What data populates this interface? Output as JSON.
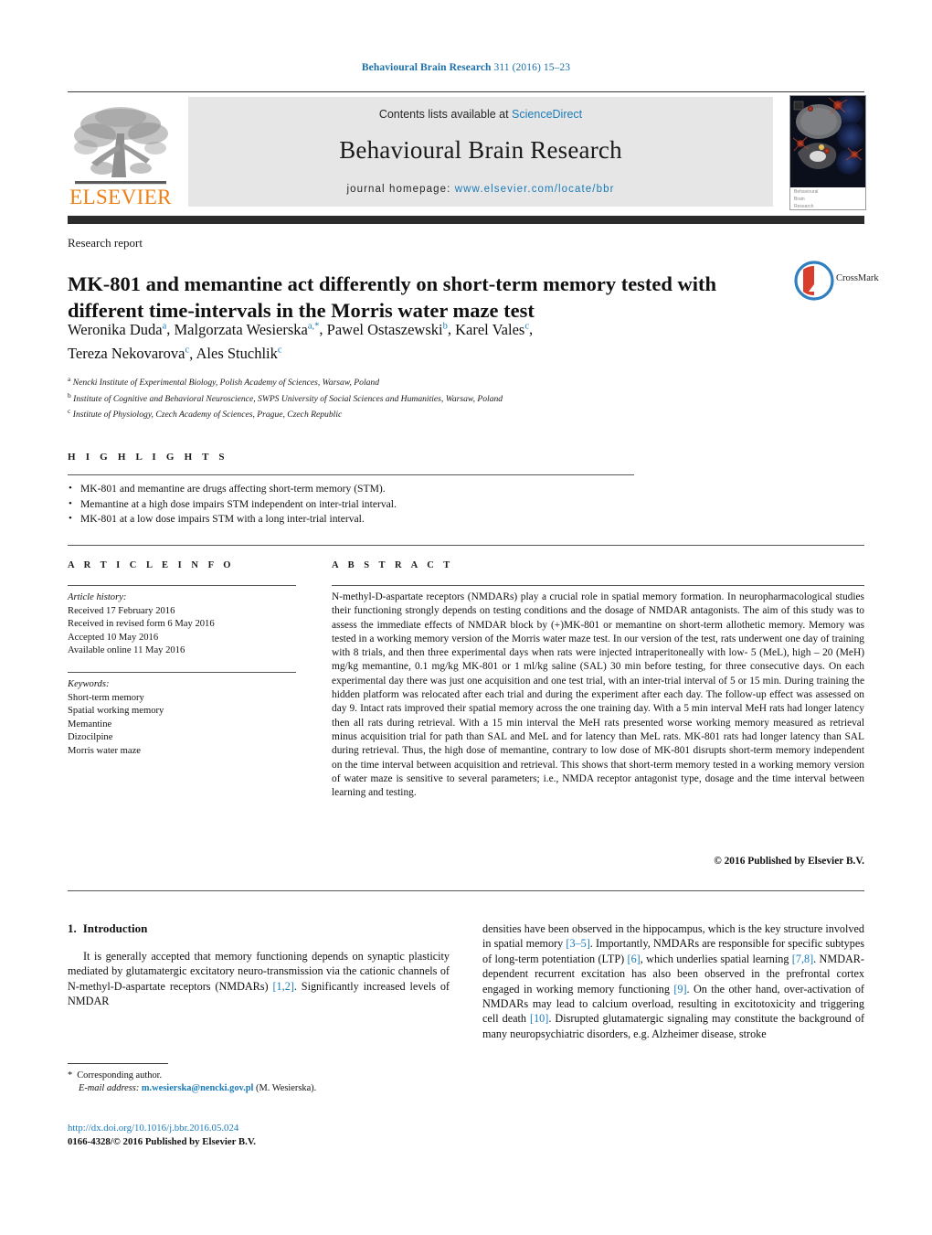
{
  "running_head": {
    "journal": "Behavioural Brain Research",
    "volume_info": "311 (2016) 15–23"
  },
  "masthead": {
    "contents_prefix": "Contents lists available at ",
    "contents_link": "ScienceDirect",
    "journal_title": "Behavioural Brain Research",
    "homepage_prefix": "journal homepage: ",
    "homepage_url": "www.elsevier.com/locate/bbr",
    "publisher_logo_text": "ELSEVIER",
    "cover_caption_line1": "Behavioural",
    "cover_caption_line2": "Brain",
    "cover_caption_line3": "Research"
  },
  "article": {
    "doctype": "Research report",
    "title": "MK-801 and memantine act differently on short-term memory tested with different time-intervals in the Morris water maze test",
    "crossmark_label": "CrossMark",
    "authors_line1": "Weronika Duda",
    "authors_html_line1_sup": "a",
    "authors": [
      {
        "name": "Weronika Duda",
        "sup": "a",
        "sep": ", "
      },
      {
        "name": "Malgorzata Wesierska",
        "sup": "a,*",
        "sep": ", "
      },
      {
        "name": "Pawel Ostaszewski",
        "sup": "b",
        "sep": ", "
      },
      {
        "name": "Karel Vales",
        "sup": "c",
        "sep": ","
      },
      {
        "name": "Tereza Nekovarova",
        "sup": "c",
        "sep": ", "
      },
      {
        "name": "Ales Stuchlik",
        "sup": "c",
        "sep": ""
      }
    ],
    "affiliations": [
      {
        "sup": "a",
        "text": "Nencki Institute of Experimental Biology, Polish Academy of Sciences, Warsaw, Poland"
      },
      {
        "sup": "b",
        "text": "Institute of Cognitive and Behavioral Neuroscience, SWPS University of Social Sciences and Humanities, Warsaw, Poland"
      },
      {
        "sup": "c",
        "text": "Institute of Physiology, Czech Academy of Sciences, Prague, Czech Republic"
      }
    ]
  },
  "highlights": {
    "heading": "H I G H L I G H T S",
    "items": [
      "MK-801 and memantine are drugs affecting short-term memory (STM).",
      "Memantine at a high dose impairs STM independent on inter-trial interval.",
      "MK-801 at a low dose impairs STM with a long inter-trial interval."
    ]
  },
  "article_info": {
    "heading": "A R T I C L E   I N F O",
    "history_label": "Article history:",
    "history": [
      "Received 17 February 2016",
      "Received in revised form 6 May 2016",
      "Accepted 10 May 2016",
      "Available online 11 May 2016"
    ],
    "keywords_label": "Keywords:",
    "keywords": [
      "Short-term memory",
      "Spatial working memory",
      "Memantine",
      "Dizocilpine",
      "Morris water maze"
    ]
  },
  "abstract": {
    "heading": "A B S T R A C T",
    "text": "N-methyl-D-aspartate receptors (NMDARs) play a crucial role in spatial memory formation. In neuropharmacological studies their functioning strongly depends on testing conditions and the dosage of NMDAR antagonists. The aim of this study was to assess the immediate effects of NMDAR block by (+)MK-801 or memantine on short-term allothetic memory. Memory was tested in a working memory version of the Morris water maze test. In our version of the test, rats underwent one day of training with 8 trials, and then three experimental days when rats were injected intraperitoneally with low- 5 (MeL), high – 20 (MeH) mg/kg memantine, 0.1 mg/kg MK-801 or 1 ml/kg saline (SAL) 30 min before testing, for three consecutive days. On each experimental day there was just one acquisition and one test trial, with an inter-trial interval of 5 or 15 min. During training the hidden platform was relocated after each trial and during the experiment after each day. The follow-up effect was assessed on day 9. Intact rats improved their spatial memory across the one training day. With a 5 min interval MeH rats had longer latency then all rats during retrieval. With a 15 min interval the MeH rats presented worse working memory measured as retrieval minus acquisition trial for path than SAL and MeL and for latency than MeL rats. MK-801 rats had longer latency than SAL during retrieval. Thus, the high dose of memantine, contrary to low dose of MK-801 disrupts short-term memory independent on the time interval between acquisition and retrieval. This shows that short-term memory tested in a working memory version of water maze is sensitive to several parameters; i.e., NMDA receptor antagonist type, dosage and the time interval between learning and testing.",
    "copyright": "© 2016 Published by Elsevier B.V."
  },
  "introduction": {
    "number": "1.",
    "heading": "Introduction",
    "left_paragraph_part1": "It is generally accepted that memory functioning depends on synaptic plasticity mediated by glutamatergic excitatory neuro-transmission via the cationic channels of N-methyl-",
    "left_small_caps": "D",
    "left_paragraph_part2": "-aspartate receptors (NMDARs) ",
    "ref_1_2": "[1,2]",
    "left_paragraph_part3": ". Significantly increased levels of NMDAR",
    "right_part1": "densities have been observed in the hippocampus, which is the key structure involved in spatial memory ",
    "ref_3_5": "[3–5]",
    "right_part2": ". Importantly, NMDARs are responsible for specific subtypes of long-term potentiation (LTP) ",
    "ref_6": "[6]",
    "right_part3": ", which underlies spatial learning ",
    "ref_7_8": "[7,8]",
    "right_part4": ". NMDAR-dependent recurrent excitation has also been observed in the prefrontal cortex engaged in working memory functioning ",
    "ref_9": "[9]",
    "right_part5": ". On the other hand, over-activation of NMDARs may lead to calcium overload, resulting in excitotoxicity and triggering cell death ",
    "ref_10": "[10]",
    "right_part6": ". Disrupted glutamatergic signaling may constitute the background of many neuropsychiatric disorders, e.g. Alzheimer disease, stroke"
  },
  "footer": {
    "corresponding_star": "*",
    "corresponding_label": "Corresponding author.",
    "email_label": "E-mail address:",
    "email": "m.wesierska@nencki.gov.pl",
    "email_owner": "(M. Wesierska).",
    "doi_url": "http://dx.doi.org/10.1016/j.bbr.2016.05.024",
    "issn_line": "0166-4328/© 2016 Published by Elsevier B.V."
  },
  "colors": {
    "link_blue": "#1a7bb9",
    "header_blue": "#1a6fa8",
    "elsevier_orange": "#f07f13",
    "masthead_grey": "#e6e6e6",
    "bar_dark": "#2b2b2b"
  }
}
